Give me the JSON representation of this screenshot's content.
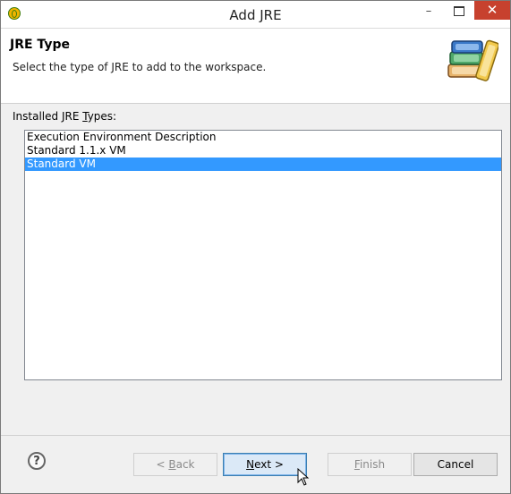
{
  "window": {
    "title": "Add JRE",
    "minimize_glyph": "–",
    "close_glyph": "✕",
    "close_color": "#c7412e"
  },
  "banner": {
    "title": "JRE Type",
    "description": "Select the type of JRE to add to the workspace.",
    "icon": "library-books-icon"
  },
  "list": {
    "label_prefix": "Installed JRE ",
    "label_mnemonic": "T",
    "label_suffix": "ypes:",
    "items": [
      {
        "label": "Execution Environment Description",
        "selected": false
      },
      {
        "label": "Standard 1.1.x VM",
        "selected": false
      },
      {
        "label": "Standard VM",
        "selected": true
      }
    ],
    "selection_color": "#3399ff"
  },
  "buttons": {
    "help": "?",
    "back": {
      "prefix": "< ",
      "mnemonic": "B",
      "suffix": "ack",
      "enabled": false
    },
    "next": {
      "prefix": "",
      "mnemonic": "N",
      "suffix": "ext >",
      "enabled": true
    },
    "finish": {
      "prefix": "",
      "mnemonic": "F",
      "suffix": "inish",
      "enabled": false
    },
    "cancel": {
      "label": "Cancel",
      "enabled": true
    }
  }
}
